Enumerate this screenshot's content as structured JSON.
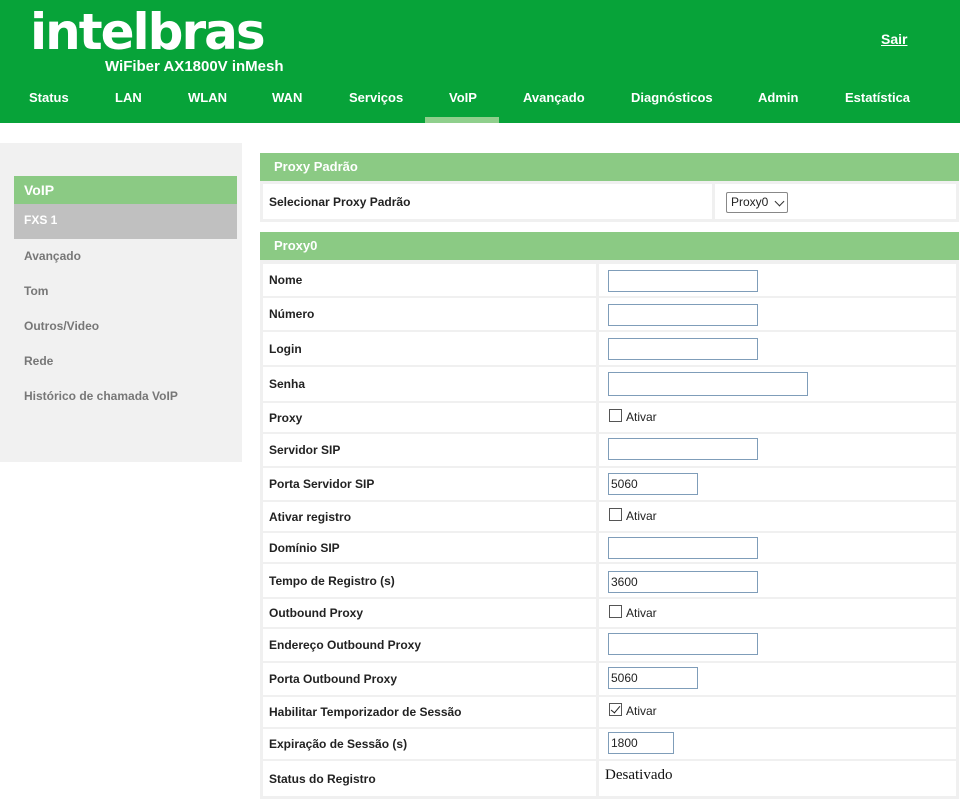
{
  "header": {
    "logo": "intelbras",
    "model": "WiFiber AX1800V inMesh",
    "logout": "Sair",
    "nav": [
      "Status",
      "LAN",
      "WLAN",
      "WAN",
      "Serviços",
      "VoIP",
      "Avançado",
      "Diagnósticos",
      "Admin",
      "Estatística"
    ],
    "active_nav": "VoIP"
  },
  "sidebar": {
    "section": "VoIP",
    "active": "FXS 1",
    "items": [
      "Avançado",
      "Tom",
      "Outros/Video",
      "Rede",
      "Histórico de chamada VoIP"
    ]
  },
  "proxy_default": {
    "title": "Proxy Padrão",
    "label": "Selecionar Proxy Padrão",
    "selected": "Proxy0"
  },
  "proxy0": {
    "title": "Proxy0",
    "nome": {
      "label": "Nome",
      "value": ""
    },
    "numero": {
      "label": "Número",
      "value": ""
    },
    "login": {
      "label": "Login",
      "value": ""
    },
    "senha": {
      "label": "Senha",
      "value": ""
    },
    "proxy": {
      "label": "Proxy",
      "checkbox": "Ativar",
      "checked": false
    },
    "servidor_sip": {
      "label": "Servidor SIP",
      "value": ""
    },
    "porta_servidor_sip": {
      "label": "Porta Servidor SIP",
      "value": "5060"
    },
    "ativar_registro": {
      "label": "Ativar registro",
      "checkbox": "Ativar",
      "checked": false
    },
    "dominio_sip": {
      "label": "Domínio SIP",
      "value": ""
    },
    "tempo_registro": {
      "label": "Tempo de Registro (s)",
      "value": "3600"
    },
    "outbound_proxy": {
      "label": "Outbound Proxy",
      "checkbox": "Ativar",
      "checked": false
    },
    "endereco_outbound": {
      "label": "Endereço Outbound Proxy",
      "value": ""
    },
    "porta_outbound": {
      "label": "Porta Outbound Proxy",
      "value": "5060"
    },
    "temporizador_sessao": {
      "label": "Habilitar Temporizador de Sessão",
      "checkbox": "Ativar",
      "checked": true
    },
    "expiracao_sessao": {
      "label": "Expiração de Sessão (s)",
      "value": "1800"
    },
    "status_registro": {
      "label": "Status do Registro",
      "value": "Desativado"
    }
  },
  "colors": {
    "brand_green": "#07a339",
    "panel_header": "#8bca84",
    "sidebar_active": "#c0c0c0"
  }
}
